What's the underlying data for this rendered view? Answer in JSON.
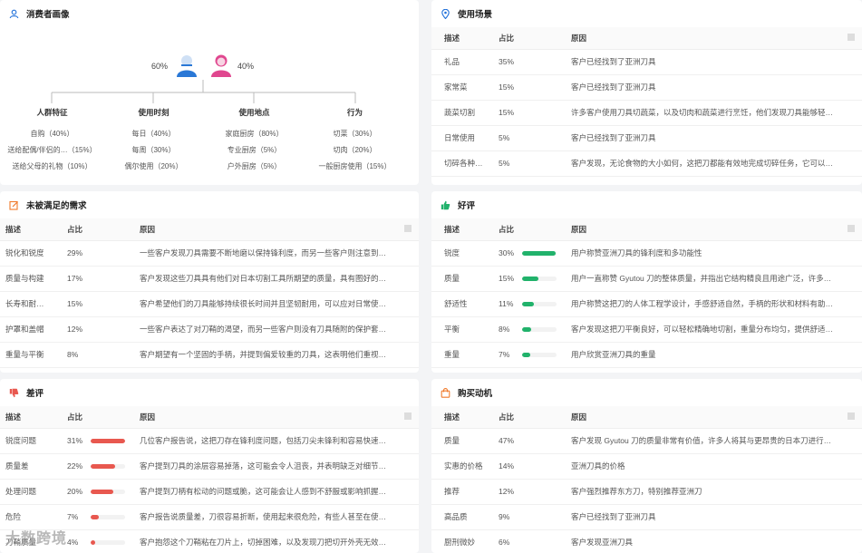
{
  "consumer_profile": {
    "title": "消费者画像",
    "male_pct": "60%",
    "female_pct": "40%",
    "categories": [
      {
        "title": "人群特征",
        "items": [
          "自购（40%）",
          "送给配偶/伴侣的…（15%）",
          "送给父母的礼物（10%）"
        ]
      },
      {
        "title": "使用时刻",
        "items": [
          "每日（40%）",
          "每周（30%）",
          "偶尔使用（20%）"
        ]
      },
      {
        "title": "使用地点",
        "items": [
          "家庭厨房（80%）",
          "专业厨房（5%）",
          "户外厨房（5%）"
        ]
      },
      {
        "title": "行为",
        "items": [
          "切菜（30%）",
          "切肉（20%）",
          "一般厨房使用（15%）"
        ]
      }
    ]
  },
  "usage_scenarios": {
    "title": "使用场景",
    "headers": [
      "描述",
      "占比",
      "原因"
    ],
    "rows": [
      {
        "desc": "礼品",
        "pct": "35%",
        "reason": "客户已经找到了亚洲刀具"
      },
      {
        "desc": "家常菜",
        "pct": "15%",
        "reason": "客户已经找到了亚洲刀具"
      },
      {
        "desc": "蔬菜切割",
        "pct": "15%",
        "reason": "许多客户使用刀具切蔬菜，以及切肉和蔬菜进行烹饪，他们发现刀具能够轻…"
      },
      {
        "desc": "日常使用",
        "pct": "5%",
        "reason": "客户已经找到了亚洲刀具"
      },
      {
        "desc": "切碎各种…",
        "pct": "5%",
        "reason": "客户发现，无论食物的大小如何，这把刀都能有效地完成切碎任务，它可以…"
      }
    ]
  },
  "unmet_needs": {
    "title": "未被满足的需求",
    "headers": [
      "描述",
      "占比",
      "原因"
    ],
    "rows": [
      {
        "desc": "锐化和锐度",
        "pct": "29%",
        "reason": "一些客户发现刀具需要不断地磨以保持锋利度，而另一些客户则注意到金刀…"
      },
      {
        "desc": "质量与构建",
        "pct": "17%",
        "reason": "客户发现这些刀具具有他们对日本切割工具所期望的质量，具有图好的抓地…"
      },
      {
        "desc": "长寿和耐…",
        "pct": "15%",
        "reason": "客户希望他们的刀具能够持续很长时间并且坚韧耐用，可以应对日常使用，…"
      },
      {
        "desc": "护罩和盖帽",
        "pct": "12%",
        "reason": "一些客户表达了对刀鞘的渴望，而另一些客户则没有刀具随附的保护套，自…"
      },
      {
        "desc": "重量与平衡",
        "pct": "8%",
        "reason": "客户期望有一个坚固的手柄，并提到偏爱较重的刀具，这表明他们重视具有…"
      }
    ]
  },
  "positive_reviews": {
    "title": "好评",
    "headers": [
      "描述",
      "占比",
      "原因"
    ],
    "bar_color": "#21b26b",
    "rows": [
      {
        "desc": "锐度",
        "pct": "30%",
        "value": 30,
        "reason": "用户称赞亚洲刀具的锋利度和多功能性"
      },
      {
        "desc": "质量",
        "pct": "15%",
        "value": 15,
        "reason": "用户一直称赞 Gyutou 刀的整体质量，并指出它结构精良且用途广泛，许多…"
      },
      {
        "desc": "舒适性",
        "pct": "11%",
        "value": 11,
        "reason": "用户称赞这把刀的人体工程学设计，手感舒适自然，手柄的形状和材料有助…"
      },
      {
        "desc": "平衡",
        "pct": "8%",
        "value": 8,
        "reason": "客户发现这把刀平衡良好，可以轻松精确地切割，重量分布均匀，提供舒适…"
      },
      {
        "desc": "重量",
        "pct": "7%",
        "value": 7,
        "reason": "用户欣赏亚洲刀具的重量"
      }
    ]
  },
  "negative_reviews": {
    "title": "差评",
    "headers": [
      "描述",
      "占比",
      "原因"
    ],
    "bar_color": "#e8584f",
    "rows": [
      {
        "desc": "锐度问题",
        "pct": "31%",
        "value": 31,
        "reason": "几位客户报告说，这把刀存在锋利度问题，包括刀尖未锋利和容易快速变钝…"
      },
      {
        "desc": "质量差",
        "pct": "22%",
        "value": 22,
        "reason": "客户提到刀具的涂层容易掉落，这可能会令人沮丧，并表明缺乏对细节的关注…"
      },
      {
        "desc": "处理问题",
        "pct": "20%",
        "value": 20,
        "reason": "客户提到刀柄有松动的问题或脆，这可能会让人感到不舒服或影响抓握力…"
      },
      {
        "desc": "危险",
        "pct": "7%",
        "value": 7,
        "reason": "客户报告说质量差，刀很容易折断，使用起来很危险，有些人甚至在使用过…"
      },
      {
        "desc": "刀鞘质量",
        "pct": "4%",
        "value": 4,
        "reason": "客户抱怨这个刀鞘粘在刀片上，切掉困难，以及发现刀把切开外壳无效，这使…"
      }
    ]
  },
  "purchase_motivation": {
    "title": "购买动机",
    "headers": [
      "描述",
      "占比",
      "原因"
    ],
    "rows": [
      {
        "desc": "质量",
        "pct": "47%",
        "reason": "客户发现 Gyutou 刀的质量非常有价值，许多人将其与更昂贵的日本刀进行…"
      },
      {
        "desc": "实惠的价格",
        "pct": "14%",
        "reason": "亚洲刀具的价格"
      },
      {
        "desc": "推荐",
        "pct": "12%",
        "reason": "客户强烈推荐东方刀，特别推荐亚洲刀"
      },
      {
        "desc": "高品质",
        "pct": "9%",
        "reason": "客户已经找到了亚洲刀具"
      },
      {
        "desc": "厨刑微妙",
        "pct": "6%",
        "reason": "客户发现亚洲刀具"
      }
    ]
  },
  "watermark": "大数跨境",
  "colors": {
    "accent": "#1e6fd9",
    "female": "#e0478f",
    "male": "#2a78d6"
  }
}
